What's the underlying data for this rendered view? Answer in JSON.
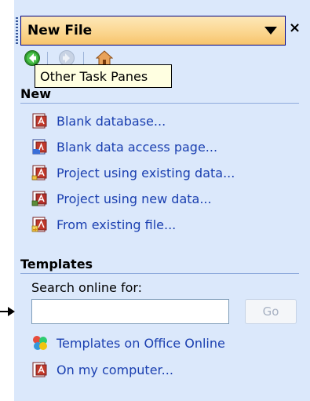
{
  "pane": {
    "title": "New File",
    "close_symbol": "×",
    "tooltip": "Other Task Panes"
  },
  "nav": {
    "icons": [
      "back-icon",
      "forward-icon",
      "home-icon"
    ]
  },
  "new_section": {
    "header": "New",
    "items": [
      {
        "label": "Blank database...",
        "icon": "blank-database-icon"
      },
      {
        "label": "Blank data access page...",
        "icon": "data-access-page-icon"
      },
      {
        "label": "Project using existing data...",
        "icon": "project-existing-data-icon"
      },
      {
        "label": "Project using new data...",
        "icon": "project-new-data-icon"
      },
      {
        "label": "From existing file...",
        "icon": "existing-file-icon"
      }
    ]
  },
  "templates_section": {
    "header": "Templates",
    "search_label": "Search online for:",
    "search_value": "",
    "go_label": "Go",
    "items": [
      {
        "label": "Templates on Office Online",
        "icon": "office-online-icon"
      },
      {
        "label": "On my computer...",
        "icon": "my-computer-templates-icon"
      }
    ]
  },
  "colors": {
    "pane_background": "#dbe8fb",
    "title_bar": "#fbd690",
    "link_text": "#1a3fb0",
    "rule": "#8eaadc",
    "tooltip_background": "#ffffe1"
  }
}
